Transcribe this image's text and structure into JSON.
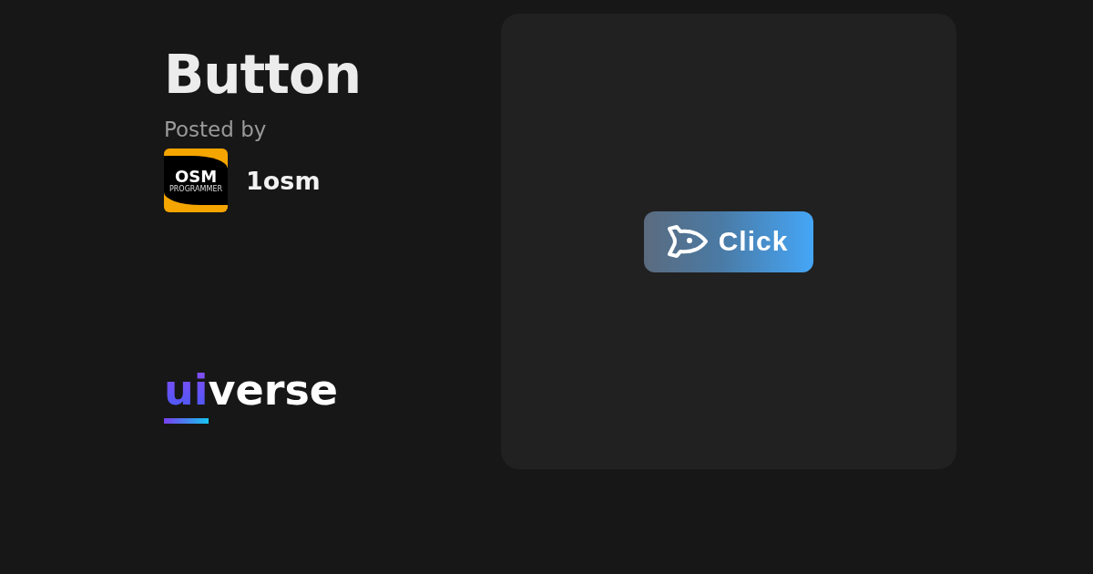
{
  "title": "Button",
  "posted_by": "Posted by",
  "author": {
    "name": "1osm",
    "avatar": {
      "mark": "OSM",
      "subtitle": "PROGRAMMER"
    }
  },
  "brand": {
    "accent": "ui",
    "rest": "verse"
  },
  "preview": {
    "button": {
      "label": "Click"
    }
  }
}
